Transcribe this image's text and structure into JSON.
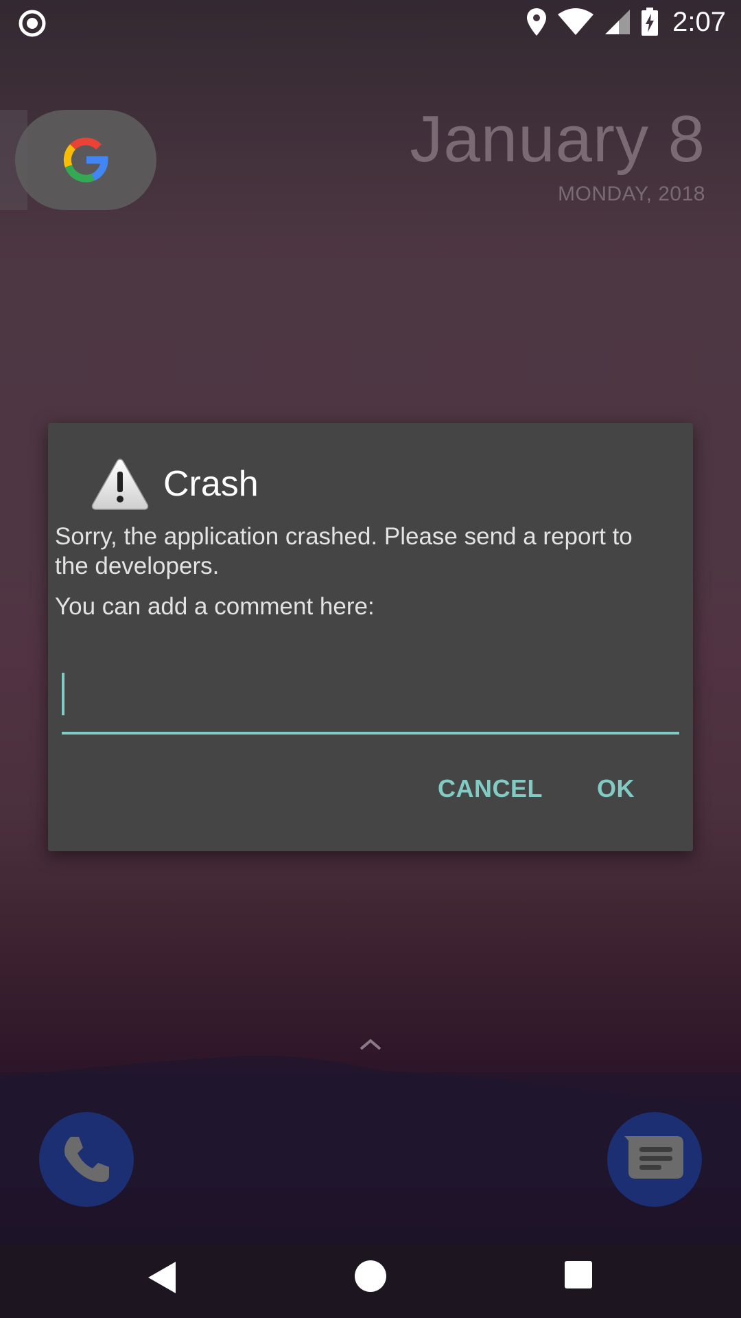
{
  "status_bar": {
    "time": "2:07",
    "icons": [
      "recording-indicator-icon",
      "location-icon",
      "wifi-icon",
      "cell-signal-icon",
      "battery-charging-icon"
    ]
  },
  "home": {
    "google_search_icon": "google-g-icon",
    "date_main": "January 8",
    "date_sub": "MONDAY, 2018",
    "app_drawer_icon": "chevron-up-icon",
    "dock": {
      "left_app_icon": "phone-icon",
      "right_app_icon": "messages-icon"
    }
  },
  "dialog": {
    "icon": "warning-icon",
    "title": "Crash",
    "message": "Sorry, the application crashed. Please send a report to the developers.",
    "comment_label": "You can add a comment here:",
    "comment_value": "",
    "cancel_label": "CANCEL",
    "ok_label": "OK",
    "accent_color": "#80cbc4",
    "background_color": "#454545"
  },
  "nav_bar": {
    "back_icon": "back-triangle-icon",
    "home_icon": "home-circle-icon",
    "recents_icon": "recents-square-icon"
  }
}
